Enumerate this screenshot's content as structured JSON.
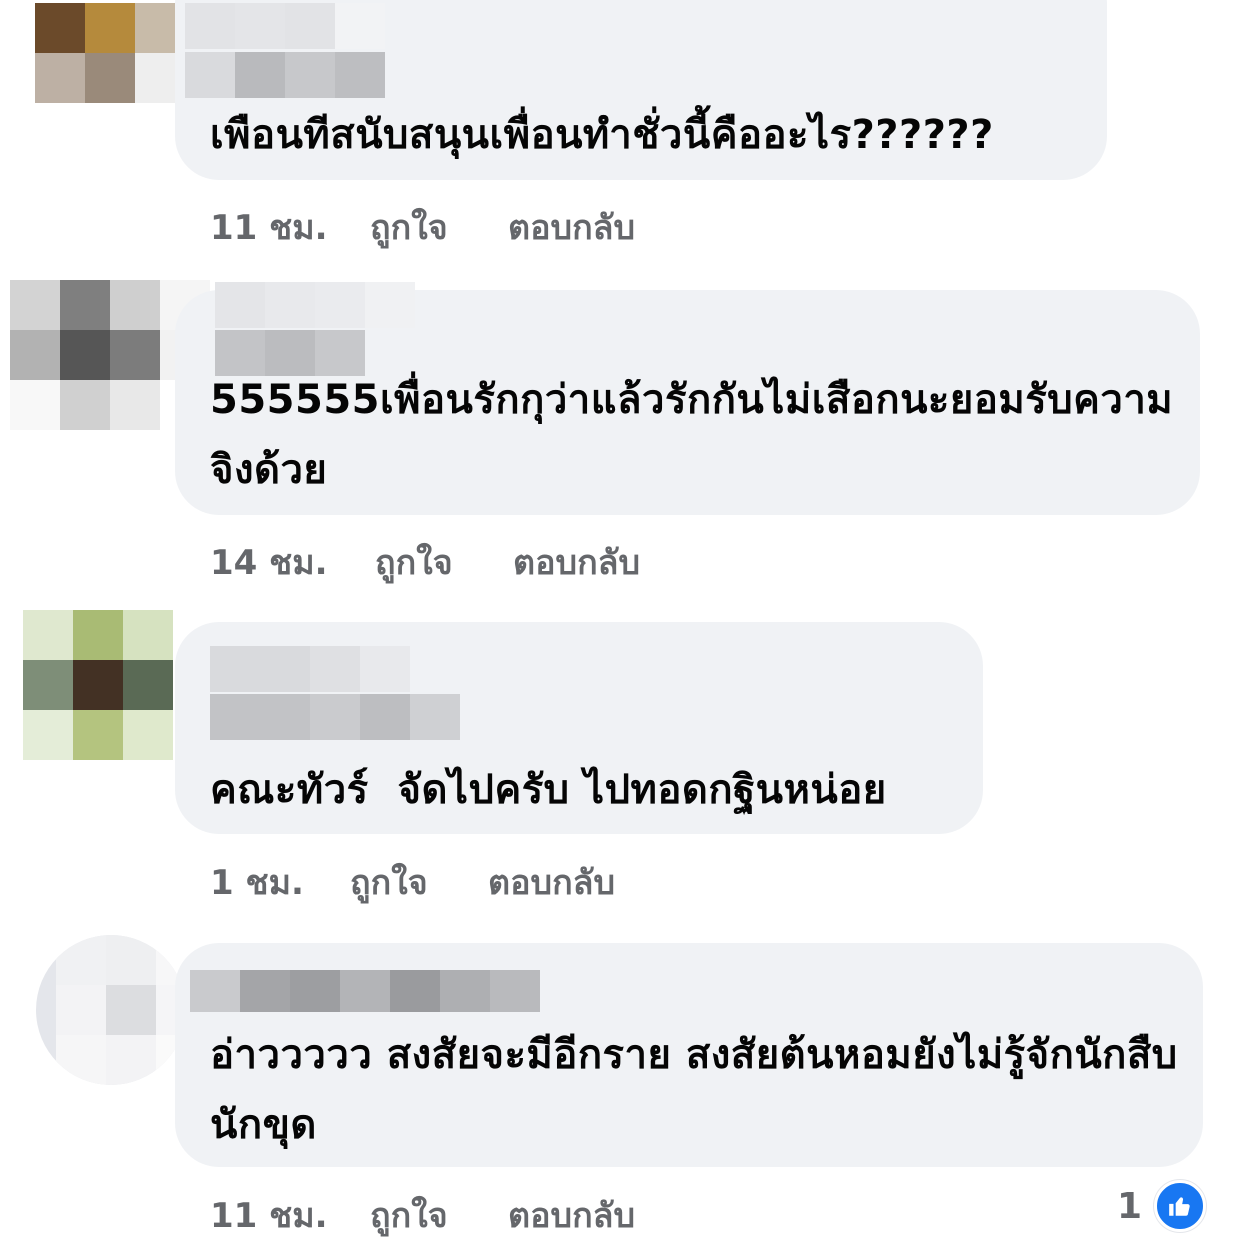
{
  "comments": [
    {
      "text": "เพือนทีสนับสนุนเพื่อนทำชั่วนี้คืออะไร??????",
      "time": "11 ชม.",
      "like_label": "ถูกใจ",
      "reply_label": "ตอบกลับ"
    },
    {
      "text": "555555เพื่อนรักกุว่าแล้วรักกันไม่เสือกนะยอมรับความจิงด้วย",
      "time": "14 ชม.",
      "like_label": "ถูกใจ",
      "reply_label": "ตอบกลับ"
    },
    {
      "text": "คณะทัวร์  จัดไปครับ ไปทอดกฐินหน่อย",
      "time": "1 ชม.",
      "like_label": "ถูกใจ",
      "reply_label": "ตอบกลับ"
    },
    {
      "text": "อ่าววววว สงสัยจะมีอีกราย สงสัยต้นหอมยังไม่รู้จักนักสืบนักขุด",
      "time": "11 ชม.",
      "like_label": "ถูกใจ",
      "reply_label": "ตอบกลับ",
      "reaction_count": "1",
      "reaction_icon": "thumbs-up-icon"
    }
  ],
  "colors": {
    "bubble": "#f0f2f5",
    "meta_text": "#65676b",
    "like_blue": "#1877f2"
  }
}
